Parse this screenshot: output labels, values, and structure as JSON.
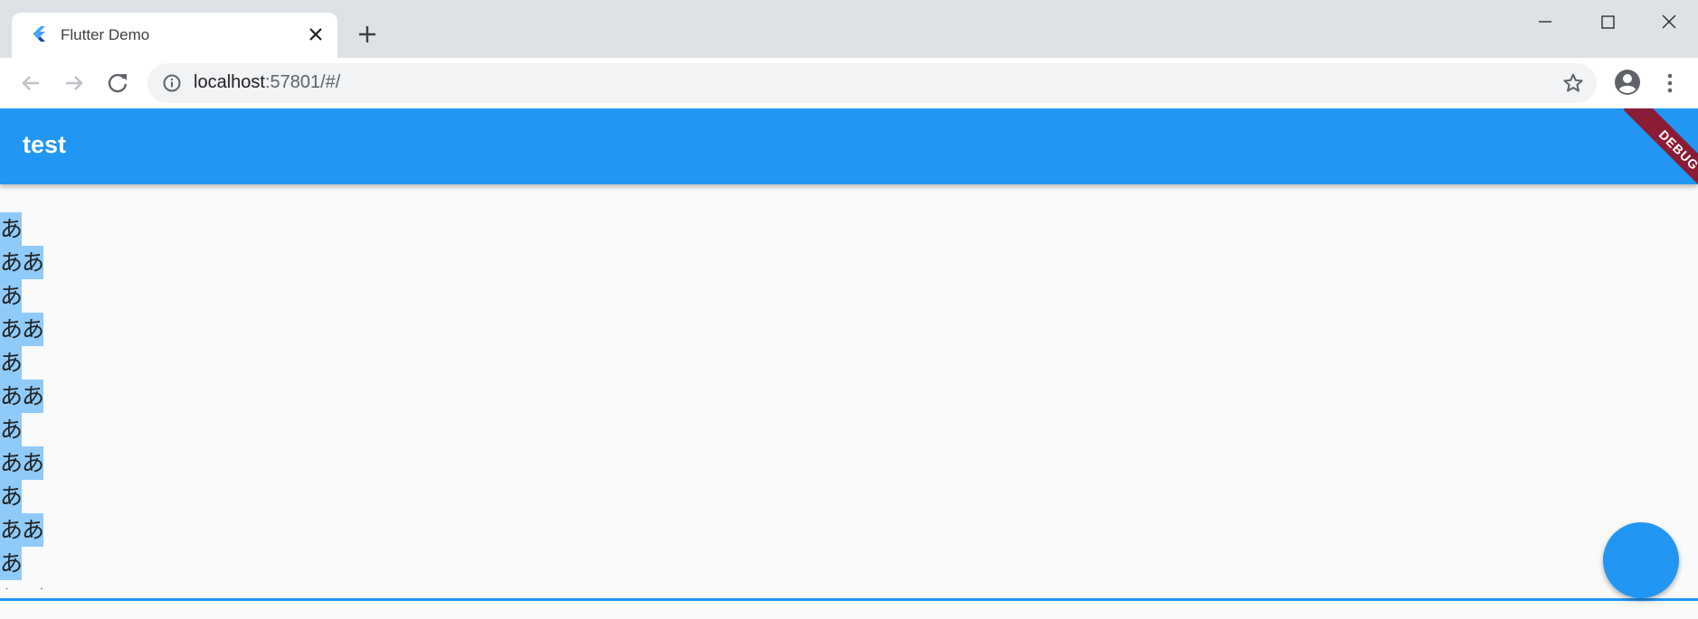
{
  "browser": {
    "tab": {
      "title": "Flutter Demo",
      "favicon": "flutter-logo-icon"
    },
    "address": {
      "host": "localhost",
      "rest": ":57801/#/"
    },
    "icons": {
      "back": "back-arrow-icon",
      "forward": "forward-arrow-icon",
      "reload": "reload-icon",
      "site_info": "info-icon",
      "bookmark": "star-icon",
      "profile": "profile-icon",
      "menu": "more-vertical-icon",
      "new_tab": "plus-icon",
      "close_tab": "close-icon",
      "minimize": "minimize-icon",
      "maximize": "maximize-icon",
      "close_window": "close-icon"
    }
  },
  "app": {
    "appbar_title": "test",
    "debug_banner": "DEBUG",
    "lines": [
      "あ",
      "ああ",
      "あ",
      "ああ",
      "あ",
      "ああ",
      "あ",
      "ああ",
      "あ",
      "ああ",
      "あ"
    ],
    "tail": ". ."
  },
  "colors": {
    "primary": "#2196f3",
    "selection": "#90caf9",
    "debug_banner": "#8b1c35",
    "background": "#fafafa"
  }
}
